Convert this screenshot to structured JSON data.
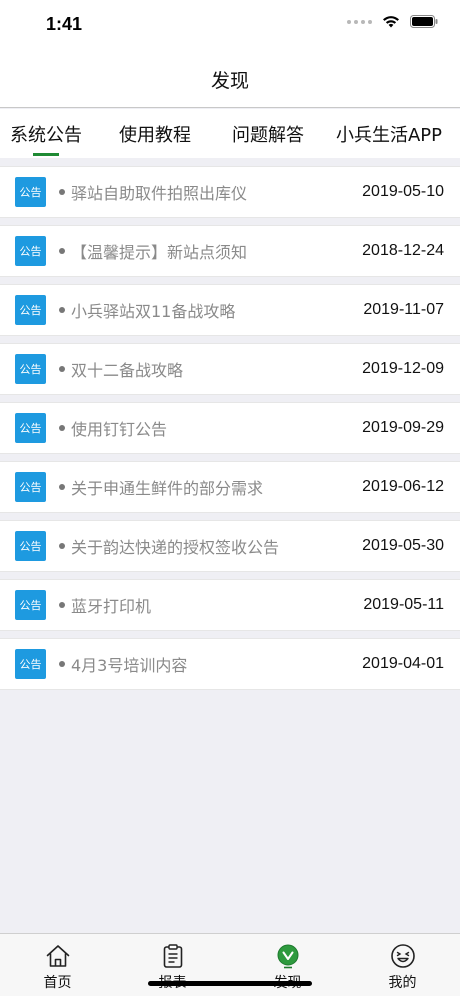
{
  "status_bar": {
    "time": "1:41"
  },
  "nav": {
    "title": "发现"
  },
  "tabs": [
    {
      "label": "系统公告",
      "active": true
    },
    {
      "label": "使用教程",
      "active": false
    },
    {
      "label": "问题解答",
      "active": false
    },
    {
      "label": "小兵生活APP",
      "active": false
    }
  ],
  "list": {
    "badge_label": "公告",
    "items": [
      {
        "title": "驿站自助取件拍照出库仪",
        "date": "2019-05-10"
      },
      {
        "title": "【温馨提示】新站点须知",
        "date": "2018-12-24"
      },
      {
        "title": "小兵驿站双11备战攻略",
        "date": "2019-11-07"
      },
      {
        "title": "双十二备战攻略",
        "date": "2019-12-09"
      },
      {
        "title": "使用钉钉公告",
        "date": "2019-09-29"
      },
      {
        "title": "关于申通生鲜件的部分需求",
        "date": "2019-06-12"
      },
      {
        "title": "关于韵达快递的授权签收公告",
        "date": "2019-05-30"
      },
      {
        "title": "蓝牙打印机",
        "date": "2019-05-11"
      },
      {
        "title": "4月3号培训内容",
        "date": "2019-04-01"
      }
    ]
  },
  "tabbar": {
    "items": [
      {
        "label": "首页",
        "icon": "home-icon"
      },
      {
        "label": "报表",
        "icon": "clipboard-icon"
      },
      {
        "label": "发现",
        "icon": "discover-icon",
        "active": true
      },
      {
        "label": "我的",
        "icon": "smiley-icon"
      }
    ]
  },
  "colors": {
    "accent": "#1f8a34",
    "badge": "#1e9ae0"
  }
}
